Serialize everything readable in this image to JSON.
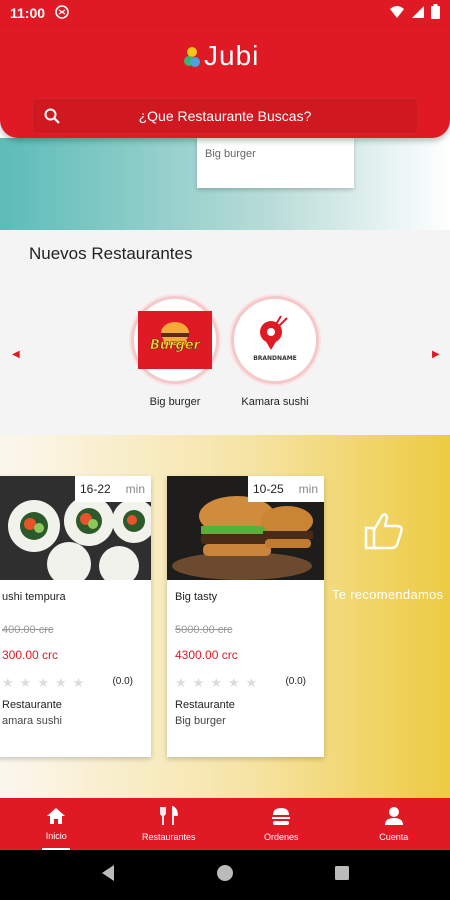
{
  "status_bar": {
    "time": "11:00"
  },
  "header": {
    "logo_text": "Jubi",
    "search_placeholder": "¿Que Restaurante Buscas?"
  },
  "banner": {
    "card_text": "Big burger"
  },
  "nuevos": {
    "title": "Nuevos Restaurantes",
    "items": [
      {
        "name": "Big burger",
        "logo_text": "Burger"
      },
      {
        "name": "Kamara sushi",
        "logo_text": "BRANDNAME"
      }
    ]
  },
  "recommendations": {
    "label": "Te recomendamos",
    "cards": [
      {
        "time_range": "16-22",
        "time_unit": "min",
        "title": "ushi tempura",
        "old_price": "400.00 crc",
        "new_price": "300.00 crc",
        "rating": "(0.0)",
        "restaurant_label": "Restaurante",
        "restaurant_name": "amara sushi"
      },
      {
        "time_range": "10-25",
        "time_unit": "min",
        "title": "Big tasty",
        "old_price": "5000.00 crc",
        "new_price": "4300.00 crc",
        "rating": "(0.0)",
        "restaurant_label": "Restaurante",
        "restaurant_name": "Big burger"
      }
    ]
  },
  "bottom_nav": {
    "items": [
      {
        "label": "Inicio",
        "icon": "home-icon"
      },
      {
        "label": "Restaurantes",
        "icon": "cutlery-icon"
      },
      {
        "label": "Ordenes",
        "icon": "burger-icon"
      },
      {
        "label": "Cuenta",
        "icon": "user-icon"
      }
    ]
  },
  "colors": {
    "brand": "#e01a24",
    "banner": "#5cbcb8",
    "reco_yellow": "#edcb42"
  }
}
